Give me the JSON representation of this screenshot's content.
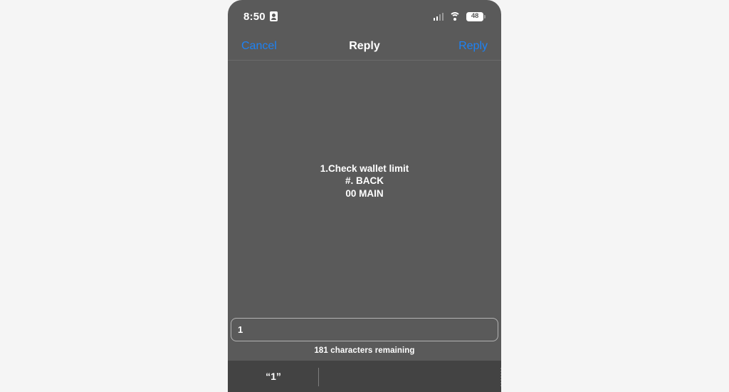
{
  "theme": {
    "page_background": "#f5f5f5",
    "screen_background": "#5a5a5a",
    "accent_blue": "#1d82f5",
    "keyboard_background": "#434343",
    "text_primary": "#ffffff"
  },
  "status_bar": {
    "time": "8:50",
    "contact_icon": "contact-card-icon",
    "signal_icon": "cellular-signal-icon",
    "wifi_icon": "wifi-icon",
    "battery": {
      "icon": "battery-icon",
      "percent_label": "48"
    }
  },
  "nav_bar": {
    "cancel_label": "Cancel",
    "title": "Reply",
    "reply_label": "Reply"
  },
  "message": {
    "lines": [
      "1.Check wallet limit",
      "#. BACK",
      "00 MAIN"
    ]
  },
  "input": {
    "value": "1",
    "placeholder": "",
    "character_count_label": "181 characters remaining"
  },
  "keyboard_suggestions": {
    "items": [
      {
        "label": "“1”"
      },
      {
        "label": ""
      },
      {
        "label": ""
      }
    ]
  }
}
